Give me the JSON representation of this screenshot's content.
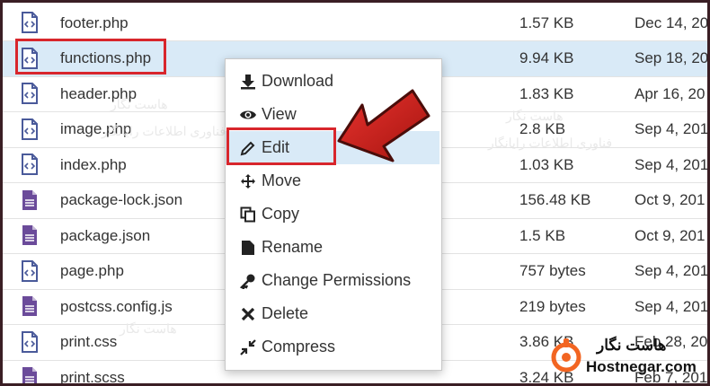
{
  "files": [
    {
      "name": "footer.php",
      "size": "1.57 KB",
      "date": "Dec 14, 20",
      "icon": "code-file-icon"
    },
    {
      "name": "functions.php",
      "size": "9.94 KB",
      "date": "Sep 18, 20",
      "icon": "code-file-icon",
      "selected": true
    },
    {
      "name": "header.php",
      "size": "1.83 KB",
      "date": "Apr 16, 20",
      "icon": "code-file-icon"
    },
    {
      "name": "image.php",
      "size": "2.8 KB",
      "date": "Sep 4, 201",
      "icon": "code-file-icon"
    },
    {
      "name": "index.php",
      "size": "1.03 KB",
      "date": "Sep 4, 201",
      "icon": "code-file-icon"
    },
    {
      "name": "package-lock.json",
      "size": "156.48 KB",
      "date": "Oct 9, 201",
      "icon": "text-file-icon"
    },
    {
      "name": "package.json",
      "size": "1.5 KB",
      "date": "Oct 9, 201",
      "icon": "text-file-icon"
    },
    {
      "name": "page.php",
      "size": "757 bytes",
      "date": "Sep 4, 201",
      "icon": "code-file-icon"
    },
    {
      "name": "postcss.config.js",
      "size": "219 bytes",
      "date": "Sep 4, 201",
      "icon": "text-file-icon"
    },
    {
      "name": "print.css",
      "size": "3.86 KB",
      "date": "Feb 28, 20",
      "icon": "code-file-icon"
    },
    {
      "name": "print.scss",
      "size": "3.24 KB",
      "date": "Feb 7, 201",
      "icon": "text-file-icon"
    }
  ],
  "context_menu": {
    "items": [
      {
        "label": "Download",
        "icon": "download-icon"
      },
      {
        "label": "View",
        "icon": "eye-icon"
      },
      {
        "label": "Edit",
        "icon": "pencil-icon",
        "active": true
      },
      {
        "label": "Move",
        "icon": "move-arrows-icon"
      },
      {
        "label": "Copy",
        "icon": "copy-icon"
      },
      {
        "label": "Rename",
        "icon": "file-icon"
      },
      {
        "label": "Change Permissions",
        "icon": "key-icon"
      },
      {
        "label": "Delete",
        "icon": "x-icon"
      },
      {
        "label": "Compress",
        "icon": "compress-icon"
      }
    ]
  },
  "watermark": {
    "fa_name": "هاست نگار",
    "fa_tagline": "فناوری اطلاعات رایانگار"
  },
  "brand": {
    "fa_name": "هاست نگار",
    "en_name": "Hostnegar.com"
  },
  "colors": {
    "highlight": "#d8262c",
    "selected_row": "#d9eaf7",
    "code_icon": "#4a5a9a",
    "text_icon": "#6b4b9a",
    "brand_orange": "#f26522"
  }
}
